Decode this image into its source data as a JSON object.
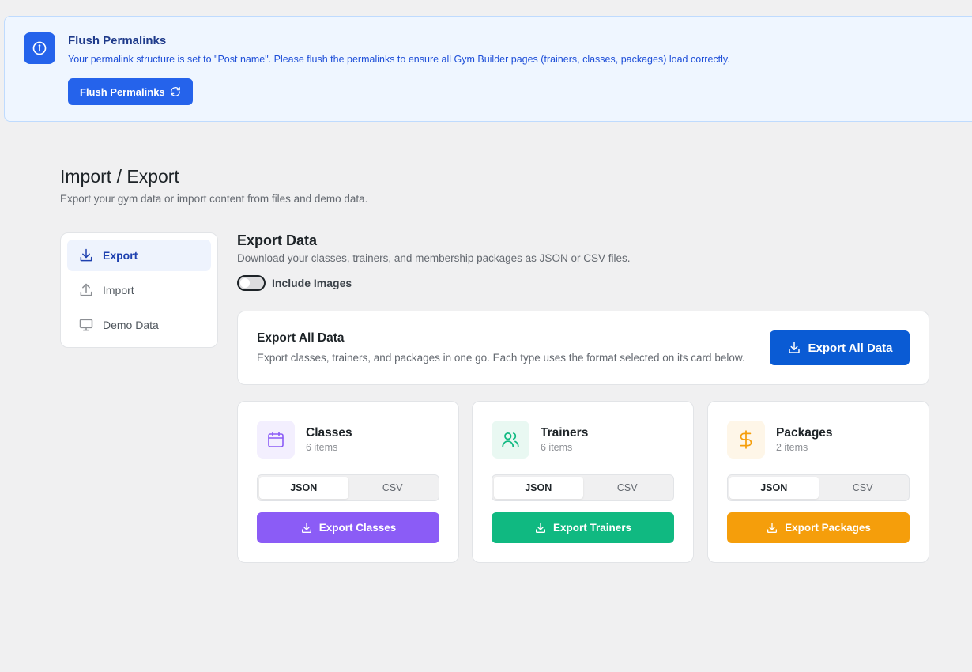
{
  "notice": {
    "title": "Flush Permalinks",
    "message": "Your permalink structure is set to \"Post name\". Please flush the permalinks to ensure all Gym Builder pages (trainers, classes, packages) load correctly.",
    "button_label": "Flush Permalinks",
    "icon": "info-icon"
  },
  "page": {
    "title": "Import / Export",
    "subtitle": "Export your gym data or import content from files and demo data."
  },
  "sidenav": {
    "items": [
      {
        "label": "Export",
        "icon": "download-icon",
        "active": true
      },
      {
        "label": "Import",
        "icon": "upload-icon",
        "active": false
      },
      {
        "label": "Demo Data",
        "icon": "monitor-icon",
        "active": false
      }
    ]
  },
  "export": {
    "title": "Export Data",
    "subtitle": "Download your classes, trainers, and membership packages as JSON or CSV files.",
    "include_images_label": "Include Images",
    "include_images": false,
    "all": {
      "title": "Export All Data",
      "description": "Export classes, trainers, and packages in one go. Each type uses the format selected on its card below.",
      "button_label": "Export All Data"
    },
    "cards": [
      {
        "title": "Classes",
        "count": "6 items",
        "icon": "calendar-icon",
        "formats": [
          "JSON",
          "CSV"
        ],
        "selected": "JSON",
        "button_label": "Export Classes",
        "color": "#8b5cf6",
        "icon_bg": "#f3effe"
      },
      {
        "title": "Trainers",
        "count": "6 items",
        "icon": "users-icon",
        "formats": [
          "JSON",
          "CSV"
        ],
        "selected": "JSON",
        "button_label": "Export Trainers",
        "color": "#10b981",
        "icon_bg": "#e9f8f2"
      },
      {
        "title": "Packages",
        "count": "2 items",
        "icon": "dollar-icon",
        "formats": [
          "JSON",
          "CSV"
        ],
        "selected": "JSON",
        "button_label": "Export Packages",
        "color": "#f59e0b",
        "icon_bg": "#fef6e8"
      }
    ]
  },
  "colors": {
    "accent": "#2563eb",
    "primary_button": "#0a5bd4"
  }
}
